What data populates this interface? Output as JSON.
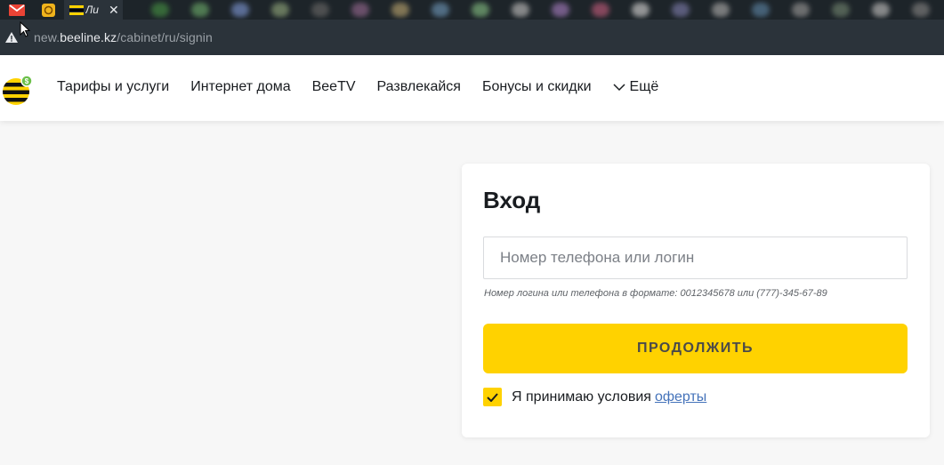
{
  "browser": {
    "active_tab_title": "Ли",
    "url_prefix": "new.",
    "url_domain": "beeline.kz",
    "url_path": "/cabinet/ru/signin",
    "blurred_tab_colors": [
      "#3d7a3d",
      "#5c8f5c",
      "#6a7fb0",
      "#7a8c6a",
      "#5a5a5a",
      "#7d5a7a",
      "#9a8a60",
      "#5e7f9a",
      "#6f9e6f",
      "#a0a0a0",
      "#8a6aa0",
      "#a0506a",
      "#b0b0b0",
      "#6a6a90",
      "#909090",
      "#50708a",
      "#808080",
      "#607060",
      "#a0a0a0",
      "#707070"
    ]
  },
  "header": {
    "nav_items": [
      "Тарифы и услуги",
      "Интернет дома",
      "BeeTV",
      "Развлекайся",
      "Бонусы и скидки"
    ],
    "more_label": "Ещё"
  },
  "login": {
    "title": "Вход",
    "input_placeholder": "Номер телефона или логин",
    "input_value": "",
    "hint": "Номер логина или телефона в формате: 0012345678 или (777)-345-67-89",
    "button_label": "ПРОДОЛЖИТЬ",
    "agree_text": "Я принимаю условия",
    "agree_link": "оферты",
    "agree_checked": true
  },
  "colors": {
    "brand_yellow": "#ffd200",
    "link_blue": "#4573ba"
  }
}
